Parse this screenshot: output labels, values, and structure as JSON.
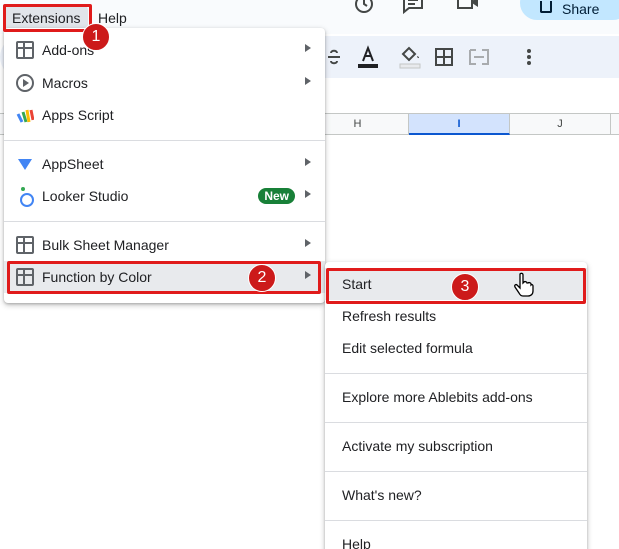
{
  "menubar": {
    "extensions_label": "Extensions",
    "help_label": "Help"
  },
  "share": {
    "label": "Share"
  },
  "columns": [
    {
      "label": "H",
      "selected": false
    },
    {
      "label": "I",
      "selected": true
    },
    {
      "label": "J",
      "selected": false
    }
  ],
  "extensions_menu": {
    "items": [
      {
        "label": "Add-ons",
        "icon": "addons-icon",
        "has_submenu": true
      },
      {
        "label": "Macros",
        "icon": "macros-icon",
        "has_submenu": true
      },
      {
        "label": "Apps Script",
        "icon": "apps-script-icon",
        "has_submenu": false
      },
      {
        "label": "AppSheet",
        "icon": "appsheet-icon",
        "has_submenu": true
      },
      {
        "label": "Looker Studio",
        "icon": "looker-studio-icon",
        "has_submenu": true,
        "badge": "New"
      },
      {
        "label": "Bulk Sheet Manager",
        "icon": "bulk-sheet-manager-icon",
        "has_submenu": true
      },
      {
        "label": "Function by Color",
        "icon": "function-by-color-icon",
        "has_submenu": true
      }
    ]
  },
  "submenu": {
    "items": [
      {
        "label": "Start"
      },
      {
        "label": "Refresh results"
      },
      {
        "label": "Edit selected formula"
      },
      {
        "label": "Explore more Ablebits add-ons"
      },
      {
        "label": "Activate my subscription"
      },
      {
        "label": "What's new?"
      },
      {
        "label": "Help"
      }
    ]
  },
  "annotations": {
    "step1": "1",
    "step2": "2",
    "step3": "3",
    "color": "#e01b1b"
  },
  "colors": {
    "accent_blue": "#0b57d0",
    "new_badge": "#188038",
    "share_bg": "#c2e7ff"
  }
}
